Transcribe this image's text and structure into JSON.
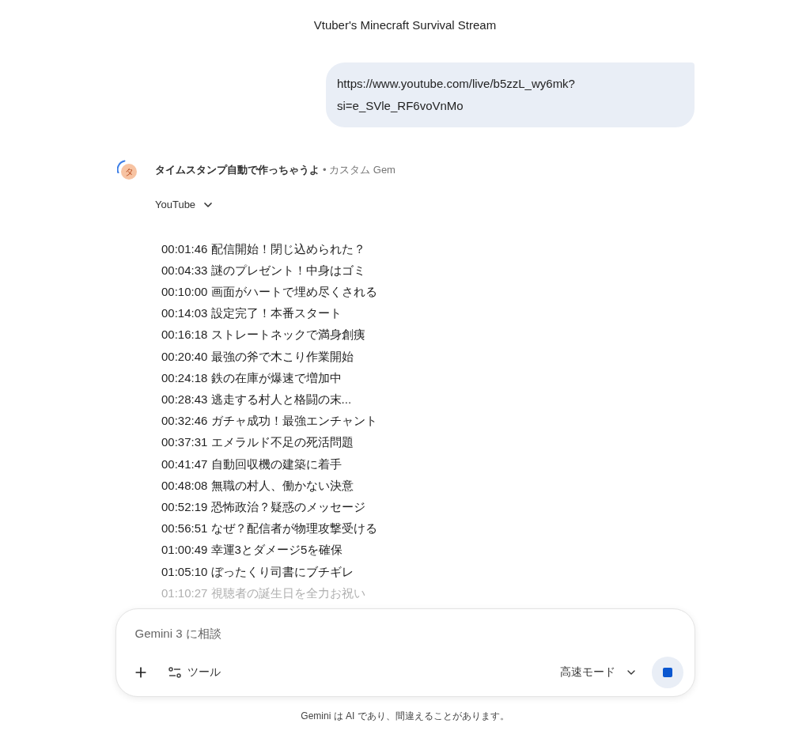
{
  "title": "Vtuber's Minecraft Survival Stream",
  "user_message": {
    "lines": [
      "https://www.youtube.com/live/b5zzL_wy6mk?",
      "si=e_SVle_RF6voVnMo"
    ]
  },
  "response": {
    "avatar_letter": "タ",
    "gem_name": "タイムスタンプ自動で作っちゃうよ",
    "gem_suffix": "• カスタム Gem",
    "loading": true,
    "tool_label": "YouTube",
    "tool_expanded": false,
    "timestamps": [
      {
        "time": "00:01:46",
        "text": "配信開始！閉じ込められた？",
        "faded": false
      },
      {
        "time": "00:04:33",
        "text": "謎のプレゼント！中身はゴミ",
        "faded": false
      },
      {
        "time": "00:10:00",
        "text": "画面がハートで埋め尽くされる",
        "faded": false
      },
      {
        "time": "00:14:03",
        "text": "設定完了！本番スタート",
        "faded": false
      },
      {
        "time": "00:16:18",
        "text": "ストレートネックで満身創痍",
        "faded": false
      },
      {
        "time": "00:20:40",
        "text": "最強の斧で木こり作業開始",
        "faded": false
      },
      {
        "time": "00:24:18",
        "text": "鉄の在庫が爆速で増加中",
        "faded": false
      },
      {
        "time": "00:28:43",
        "text": "逃走する村人と格闘の末...",
        "faded": false
      },
      {
        "time": "00:32:46",
        "text": "ガチャ成功！最強エンチャント",
        "faded": false
      },
      {
        "time": "00:37:31",
        "text": "エメラルド不足の死活問題",
        "faded": false
      },
      {
        "time": "00:41:47",
        "text": "自動回収機の建築に着手",
        "faded": false
      },
      {
        "time": "00:48:08",
        "text": "無職の村人、働かない決意",
        "faded": false
      },
      {
        "time": "00:52:19",
        "text": "恐怖政治？疑惑のメッセージ",
        "faded": false
      },
      {
        "time": "00:56:51",
        "text": "なぜ？配信者が物理攻撃受ける",
        "faded": false
      },
      {
        "time": "01:00:49",
        "text": "幸運3とダメージ5を確保",
        "faded": false
      },
      {
        "time": "01:05:10",
        "text": "ぼったくり司書にブチギレ",
        "faded": false
      },
      {
        "time": "01:10:27",
        "text": "視聴者の誕生日を全力お祝い",
        "faded": true
      }
    ]
  },
  "composer": {
    "placeholder": "Gemini 3 に相談",
    "tools_label": "ツール",
    "mode_label": "高速モード",
    "generating": true
  },
  "disclaimer": "Gemini は AI であり、間違えることがあります。"
}
